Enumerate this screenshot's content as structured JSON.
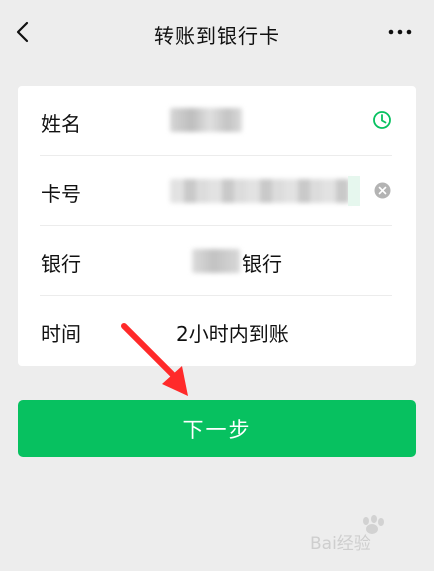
{
  "nav": {
    "title": "转账到银行卡",
    "back_icon": "chevron-left-icon",
    "more_icon": "more-dots-icon"
  },
  "form": {
    "rows": [
      {
        "label": "姓名",
        "value": "",
        "icon": "clock-icon"
      },
      {
        "label": "卡号",
        "value": "",
        "icon": "clear-icon"
      },
      {
        "label": "银行",
        "value_suffix": "银行"
      },
      {
        "label": "时间",
        "value": "2小时内到账"
      }
    ]
  },
  "next_button": {
    "label": "下一步"
  },
  "watermark": {
    "text": "Bai经验"
  },
  "colors": {
    "accent": "#07c160",
    "background": "#ededed",
    "card": "#ffffff",
    "annotation": "#ff2a2a"
  }
}
